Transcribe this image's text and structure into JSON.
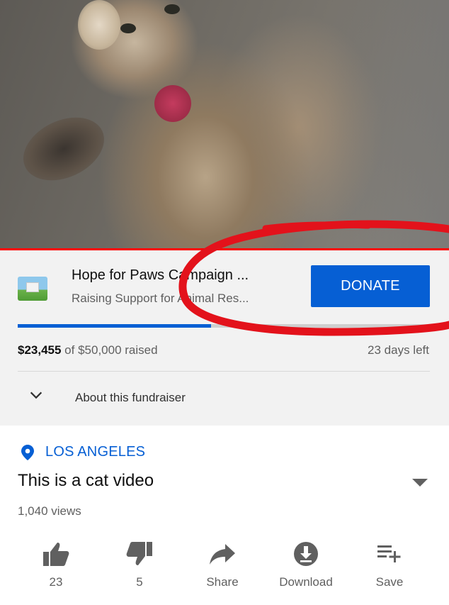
{
  "video": {
    "thumbnail": "cat-video-frame",
    "progress_color": "#ff0000"
  },
  "fundraiser": {
    "title": "Hope for Paws Campaign ...",
    "subtitle": "Raising Support for Animal Res...",
    "donate_label": "DONATE",
    "raised_amount": "$23,455",
    "raised_rest": " of $50,000 raised",
    "days_left": "23 days left",
    "progress_fraction": 0.469,
    "about_label": "About this fundraiser"
  },
  "info": {
    "location": "LOS ANGELES",
    "title": "This is a cat video",
    "views": "1,040 views"
  },
  "actions": [
    {
      "label": "23",
      "icon": "thumbs-up-icon"
    },
    {
      "label": "5",
      "icon": "thumbs-down-icon"
    },
    {
      "label": "Share",
      "icon": "share-icon"
    },
    {
      "label": "Download",
      "icon": "download-icon"
    },
    {
      "label": "Save",
      "icon": "save-playlist-icon"
    }
  ],
  "colors": {
    "accent": "#065fd4",
    "annotation": "#e3121b",
    "panel_bg": "#f2f2f2",
    "secondary_text": "#606060"
  }
}
